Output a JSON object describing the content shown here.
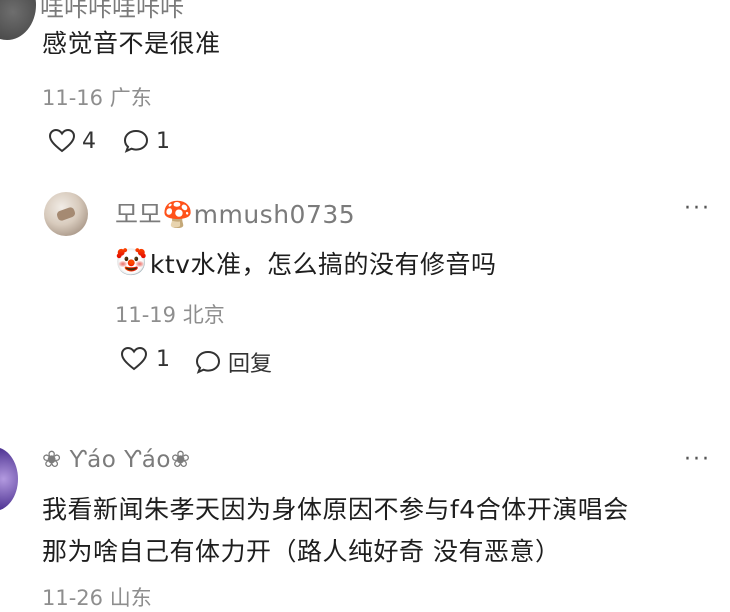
{
  "comment_top": {
    "username": "哇咔咔哇咔咔",
    "text": "感觉音不是很准",
    "time": "11-16",
    "location": "广东",
    "likes": "4",
    "replies": "1"
  },
  "reply": {
    "username": "모모🍄mmush0735",
    "emoji": "🤡",
    "text": "ktv水准，怎么搞的没有修音吗",
    "time": "11-19",
    "location": "北京",
    "likes": "1",
    "reply_label": "回复",
    "more": "···"
  },
  "comment_bottom": {
    "username": "❀ Ƴáo Ƴáo❀",
    "line1": "我看新闻朱孝天因为身体原因不参与f4合体开演唱会",
    "line2": "那为啥自己有体力开（路人纯好奇 没有恶意）",
    "time": "11-26",
    "location": "山东",
    "more": "···"
  },
  "colors": {
    "text": "#1e1e1e",
    "meta": "#8e8e8e",
    "name": "#7b7b7b"
  }
}
